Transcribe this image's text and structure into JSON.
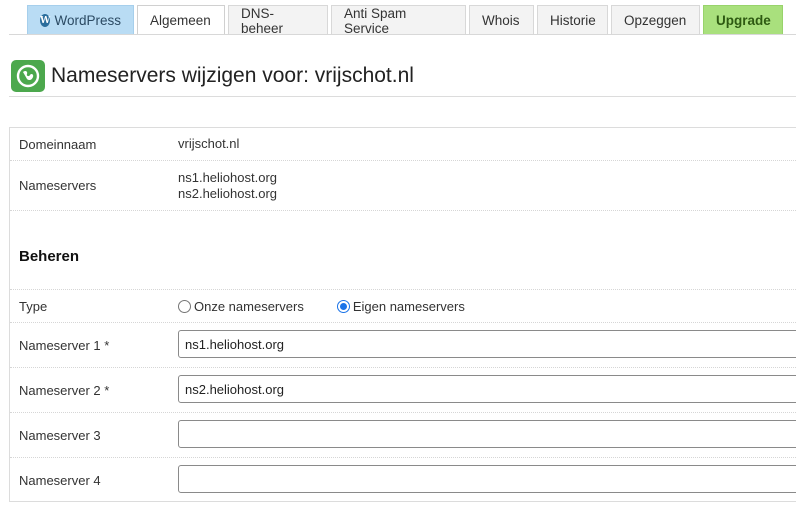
{
  "tabs": [
    {
      "label": "WordPress"
    },
    {
      "label": "Algemeen"
    },
    {
      "label": "DNS-beheer"
    },
    {
      "label": "Anti Spam Service"
    },
    {
      "label": "Whois"
    },
    {
      "label": "Historie"
    },
    {
      "label": "Opzeggen"
    },
    {
      "label": "Upgrade"
    }
  ],
  "page": {
    "title": "Nameservers wijzigen voor: vrijschot.nl"
  },
  "info": {
    "domain_label": "Domeinnaam",
    "domain_value": "vrijschot.nl",
    "ns_label": "Nameservers",
    "ns_values": [
      "ns1.heliohost.org",
      "ns2.heliohost.org"
    ]
  },
  "manage": {
    "title": "Beheren",
    "type_label": "Type",
    "options": [
      {
        "label": "Onze nameservers",
        "checked": false
      },
      {
        "label": "Eigen nameservers",
        "checked": true
      }
    ],
    "fields": [
      {
        "label": "Nameserver 1 *",
        "value": "ns1.heliohost.org"
      },
      {
        "label": "Nameserver 2 *",
        "value": "ns2.heliohost.org"
      },
      {
        "label": "Nameserver 3",
        "value": ""
      },
      {
        "label": "Nameserver 4",
        "value": ""
      }
    ]
  },
  "colors": {
    "wordpress_tab": "#b9dcf4",
    "upgrade_tab": "#a9e07d",
    "logo": "#4ca84d",
    "radio_selected": "#1a73e8"
  },
  "icons": {
    "wordpress": "wordpress-icon",
    "logo": "globe-logo-icon"
  }
}
